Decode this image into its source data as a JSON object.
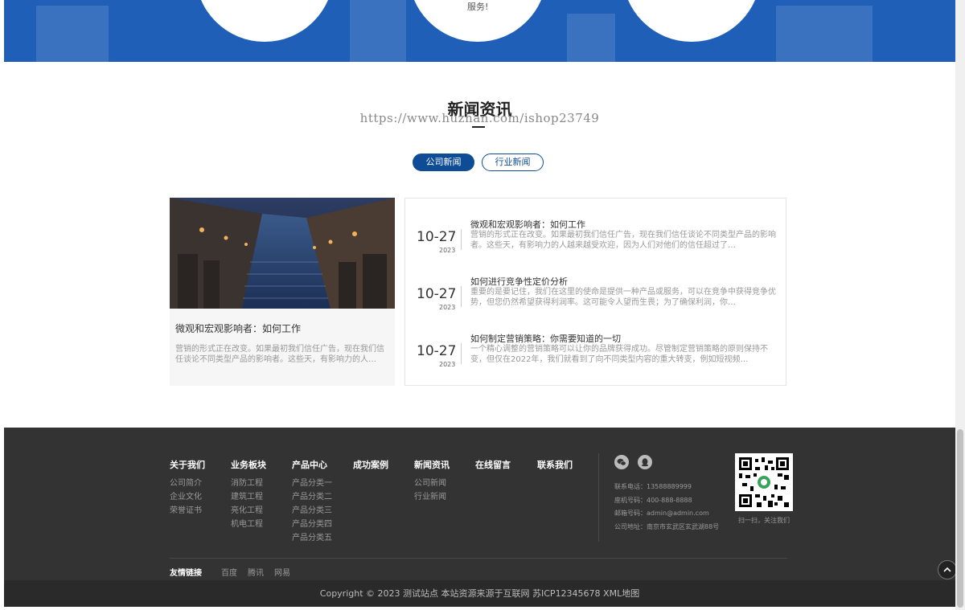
{
  "banner": {
    "service_text": "服务!"
  },
  "news": {
    "title": "新闻资讯",
    "watermark": "https://www.huzhan.com/ishop23749",
    "tabs": [
      "公司新闻",
      "行业新闻"
    ],
    "featured": {
      "title": "微观和宏观影响者：如何工作",
      "desc": "营销的形式正在改变。如果最初我们信任广告，现在我们信任谈论不同类型产品的影响者。这些天，有影响力的人…"
    },
    "items": [
      {
        "day": "10-27",
        "year": "2023",
        "title": "微观和宏观影响者：如何工作",
        "desc": "营销的形式正在改变。如果最初我们信任广告，现在我们信任谈论不同类型产品的影响者。这些天，有影响力的人越来越受欢迎，因为人们对他们的信任超过了…"
      },
      {
        "day": "10-27",
        "year": "2023",
        "title": "如何进行竞争性定价分析",
        "desc": "重要的是要记住，我们在这里的使命是提供一种产品或服务，可以在竞争中获得竞争优势，但您仍然希望获得利润率。这可能令人望而生畏；为了确保利润，你…"
      },
      {
        "day": "10-27",
        "year": "2023",
        "title": "如何制定营销策略：你需要知道的一切",
        "desc": "一个精心调整的营销策略可以让你的品牌获得成功。尽管制定营销策略的原则保持不变，但仅在2022年，我们就看到了向不同类型内容的重大转变，例如短视频…"
      }
    ]
  },
  "footer": {
    "columns": [
      {
        "heading": "关于我们",
        "links": [
          "公司简介",
          "企业文化",
          "荣誉证书"
        ]
      },
      {
        "heading": "业务板块",
        "links": [
          "消防工程",
          "建筑工程",
          "亮化工程",
          "机电工程"
        ]
      },
      {
        "heading": "产品中心",
        "links": [
          "产品分类一",
          "产品分类二",
          "产品分类三",
          "产品分类四",
          "产品分类五"
        ]
      },
      {
        "heading": "成功案例",
        "links": []
      },
      {
        "heading": "新闻资讯",
        "links": [
          "公司新闻",
          "行业新闻"
        ]
      },
      {
        "heading": "在线留言",
        "links": []
      },
      {
        "heading": "联系我们",
        "links": []
      }
    ],
    "contact": [
      "联系电话：13588889999",
      "座机号码：400-888-8888",
      "邮箱号码：admin@admin.com",
      "公司地址：南京市玄武区玄武湖88号"
    ],
    "qr_caption": "扫一扫，关注我们",
    "links_heading": "友情链接",
    "friend_links": [
      "百度",
      "腾讯",
      "网易"
    ],
    "copyright": "Copyright © 2023 测试站点 本站资源来源于互联网  苏ICP12345678  XML地图"
  }
}
